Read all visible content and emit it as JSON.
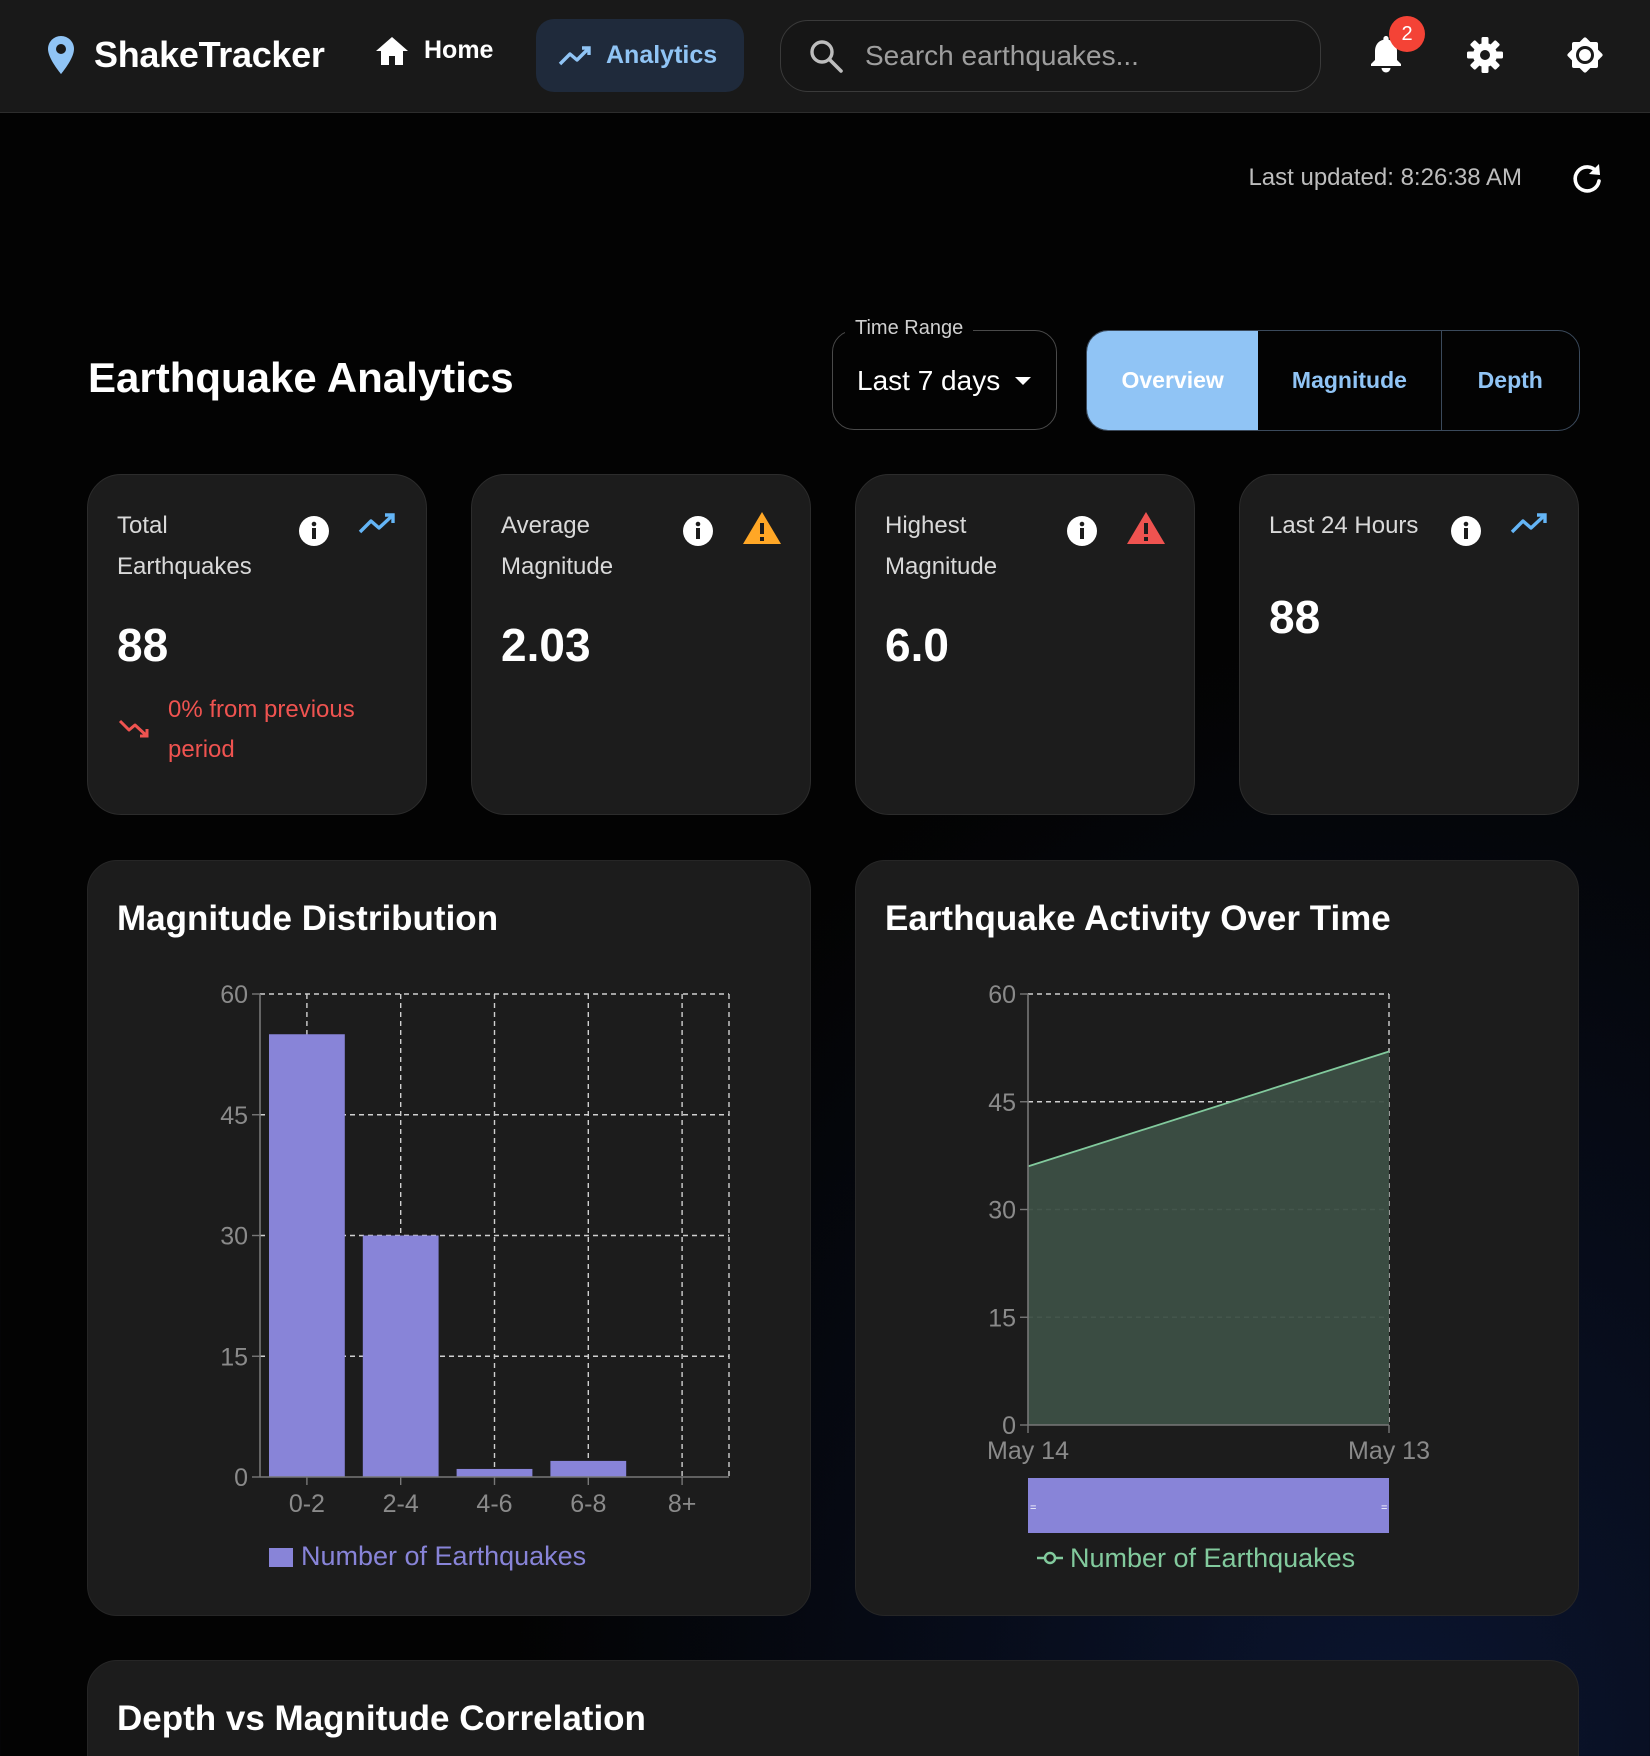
{
  "nav": {
    "brand": "ShakeTracker",
    "home_label": "Home",
    "analytics_label": "Analytics",
    "search_placeholder": "Search earthquakes...",
    "notification_count": "2",
    "icons": [
      "location-pin-icon",
      "home-icon",
      "trending-up-icon",
      "search-icon",
      "bell-icon",
      "gear-icon",
      "brightness-icon"
    ]
  },
  "status": {
    "last_updated": "Last updated: 8:26:38 AM"
  },
  "page": {
    "title": "Earthquake Analytics",
    "time_range_label": "Time Range",
    "time_range_value": "Last 7 days",
    "tabs": [
      {
        "label": "Overview",
        "active": true
      },
      {
        "label": "Magnitude",
        "active": false
      },
      {
        "label": "Depth",
        "active": false
      }
    ]
  },
  "stats": [
    {
      "label": "Total Earthquakes",
      "value": "88",
      "change": "0% from previous period",
      "status_icon": "trending-up-icon"
    },
    {
      "label": "Average Magnitude",
      "value": "2.03",
      "status_icon": "warning-icon",
      "status_color": "#ffa726"
    },
    {
      "label": "Highest Magnitude",
      "value": "6.0",
      "status_icon": "error-icon",
      "status_color": "#ef5350"
    },
    {
      "label": "Last 24 Hours",
      "value": "88",
      "status_icon": "trending-up-icon"
    }
  ],
  "colors": {
    "accent": "#90c4f5",
    "bar": "#8884d8",
    "area_line": "#82ca9d",
    "area_fill": "#3c4f45",
    "danger": "#ef5350",
    "warning": "#ffa726"
  },
  "panels": {
    "magnitude_title": "Magnitude Distribution",
    "activity_title": "Earthquake Activity Over Time",
    "depth_title": "Depth vs Magnitude Correlation"
  },
  "chart_data": [
    {
      "type": "bar",
      "title": "Magnitude Distribution",
      "categories": [
        "0-2",
        "2-4",
        "4-6",
        "6-8",
        "8+"
      ],
      "series": [
        {
          "name": "Number of Earthquakes",
          "values": [
            55,
            30,
            1,
            2,
            0
          ]
        }
      ],
      "ylim": [
        0,
        60
      ],
      "yticks": [
        0,
        15,
        30,
        45,
        60
      ],
      "grid": true,
      "legend": "bottom"
    },
    {
      "type": "area",
      "title": "Earthquake Activity Over Time",
      "x": [
        "May 14",
        "May 13"
      ],
      "series": [
        {
          "name": "Number of Earthquakes",
          "values": [
            36,
            52
          ]
        }
      ],
      "ylim": [
        0,
        60
      ],
      "yticks": [
        0,
        15,
        30,
        45,
        60
      ],
      "grid": true,
      "brush": true,
      "legend": "bottom"
    }
  ]
}
